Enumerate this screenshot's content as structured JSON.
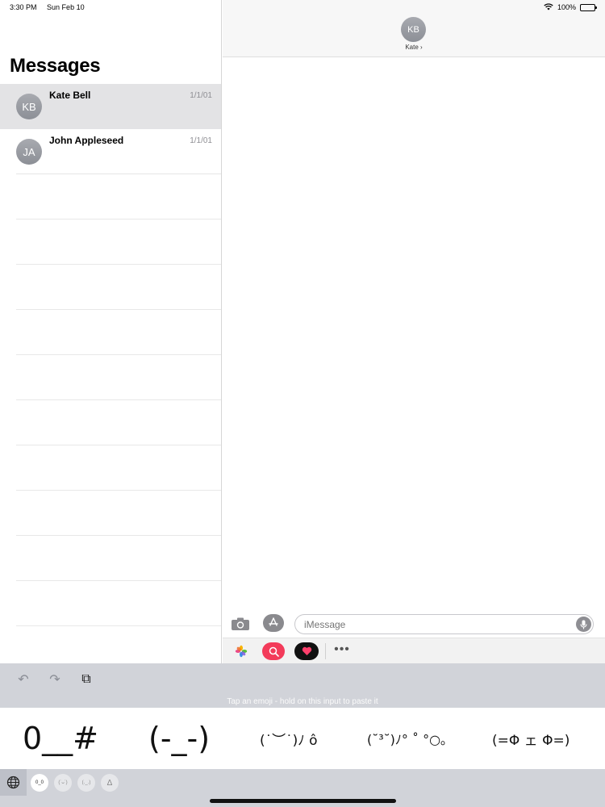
{
  "status_bar": {
    "time": "3:30 PM",
    "date": "Sun Feb 10",
    "battery": "100%"
  },
  "sidebar": {
    "title": "Messages",
    "conversations": [
      {
        "initials": "KB",
        "name": "Kate Bell",
        "date": "1/1/01",
        "selected": true
      },
      {
        "initials": "JA",
        "name": "John Appleseed",
        "date": "1/1/01",
        "selected": false
      }
    ]
  },
  "conversation_header": {
    "initials": "KB",
    "name": "Kate",
    "chevron": "›"
  },
  "compose": {
    "placeholder": "iMessage",
    "camera_icon": "camera-icon",
    "appstore_icon": "app-store-icon",
    "mic_icon": "microphone-icon"
  },
  "app_strip": {
    "items": [
      "photos-app-icon",
      "image-search-app-icon",
      "digital-touch-heart-icon",
      "more-apps-icon"
    ],
    "more_label": "•••"
  },
  "keyboard": {
    "toolbar": {
      "undo": "↶",
      "redo": "↷",
      "paste": "⧉"
    },
    "hint": "Tap an emoji - hold on this input to paste it",
    "kaomoji": [
      "0__#",
      "(-_-)",
      "(˙︶˙)ﾉ ô",
      "(˘³˘)ﾉ° ˚ °○｡",
      "(=Φ ェ Φ=)"
    ],
    "categories": [
      "0_0",
      "(˙ᴗ˙)",
      "(._.)",
      "Δ"
    ],
    "colors": {
      "keyboard_bg": "#d1d3d9",
      "accent_pink": "#f33b5a"
    }
  }
}
